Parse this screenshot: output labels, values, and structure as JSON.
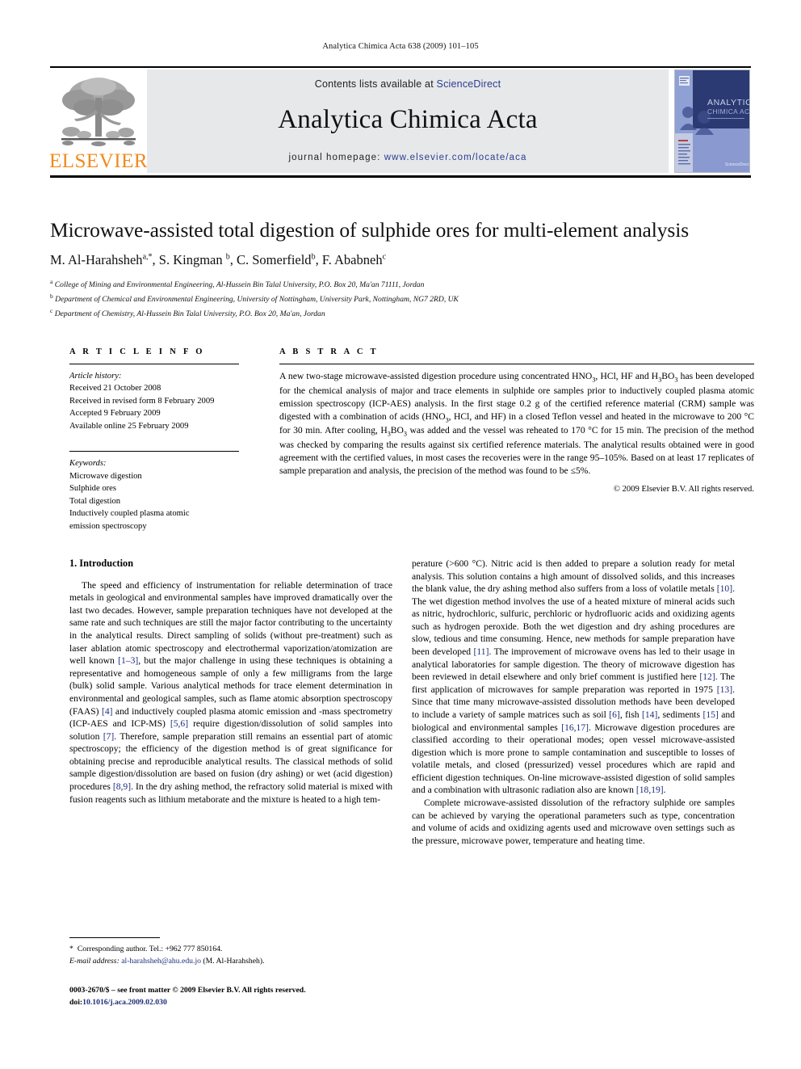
{
  "running_head": "Analytica Chimica Acta 638 (2009) 101–105",
  "masthead": {
    "contents_prefix": "Contents lists available at ",
    "sciencedirect": "ScienceDirect",
    "journal_name": "Analytica Chimica Acta",
    "homepage_label": "journal homepage:",
    "homepage_url": "www.elsevier.com/locate/aca",
    "publisher_wordmark": "ELSEVIER",
    "publisher_logo_icon": "elsevier-tree-icon",
    "cover_thumbnail_icon": "journal-cover-thumbnail",
    "cover_title_line1": "ANALYTICA",
    "cover_title_line2": "CHIMICA ACTA",
    "accent_orange": "#f08a1b",
    "link_blue": "#2a3d8f",
    "panel_grey": "#e7e8ea"
  },
  "article": {
    "title": "Microwave-assisted total digestion of sulphide ores for multi-element analysis",
    "authors_html": "M. Al-Harahsheh<sup>a,</sup><sup>*</sup>, S. Kingman <sup>b</sup>, C. Somerfield<sup>b</sup>, F. Ababneh<sup>c</sup>",
    "affiliations": [
      {
        "marker": "a",
        "text": "College of Mining and Environmental Engineering, Al-Hussein Bin Talal University, P.O. Box 20, Ma'an 71111, Jordan"
      },
      {
        "marker": "b",
        "text": "Department of Chemical and Environmental Engineering, University of Nottingham, University Park, Nottingham, NG7 2RD, UK"
      },
      {
        "marker": "c",
        "text": "Department of Chemistry, Al-Hussein Bin Talal University, P.O. Box 20, Ma'an, Jordan"
      }
    ]
  },
  "article_info": {
    "heading": "A R T I C L E  I N F O",
    "history_label": "Article history:",
    "history": [
      "Received 21 October 2008",
      "Received in revised form 8 February 2009",
      "Accepted 9 February 2009",
      "Available online 25 February 2009"
    ],
    "keywords_label": "Keywords:",
    "keywords": [
      "Microwave digestion",
      "Sulphide ores",
      "Total digestion",
      "Inductively coupled plasma atomic",
      "emission spectroscopy"
    ]
  },
  "abstract": {
    "heading": "A B S T R A C T",
    "body_html": "A new two-stage microwave-assisted digestion procedure using concentrated HNO<sub>3</sub>, HCl, HF and H<sub>3</sub>BO<sub>3</sub> has been developed for the chemical analysis of major and trace elements in sulphide ore samples prior to inductively coupled plasma atomic emission spectroscopy (ICP-AES) analysis. In the first stage 0.2 g of the certified reference material (CRM) sample was digested with a combination of acids (HNO<sub>3</sub>, HCl, and HF) in a closed Teflon vessel and heated in the microwave to 200 &deg;C for 30 min. After cooling, H<sub>3</sub>BO<sub>3</sub> was added and the vessel was reheated to 170 &deg;C for 15 min. The precision of the method was checked by comparing the results against six certified reference materials. The analytical results obtained were in good agreement with the certified values, in most cases the recoveries were in the range 95–105%. Based on at least 17 replicates of sample preparation and analysis, the precision of the method was found to be &le;5%.",
    "copyright": "© 2009 Elsevier B.V. All rights reserved."
  },
  "body": {
    "section_heading": "1.  Introduction",
    "left_paragraph_html": "The speed and efficiency of instrumentation for reliable determination of trace metals in geological and environmental samples have improved dramatically over the last two decades. However, sample preparation techniques have not developed at the same rate and such techniques are still the major factor contributing to the uncertainty in the analytical results. Direct sampling of solids (without pre-treatment) such as laser ablation atomic spectroscopy and electrothermal vaporization/atomization are well known <span class=\"ref\">[1–3]</span>, but the major challenge in using these techniques is obtaining a representative and homogeneous sample of only a few milligrams from the large (bulk) solid sample. Various analytical methods for trace element determination in environmental and geological samples, such as flame atomic absorption spectroscopy (FAAS) <span class=\"ref\">[4]</span> and inductively coupled plasma atomic emission and -mass spectrometry (ICP-AES and ICP-MS) <span class=\"ref\">[5,6]</span> require digestion/dissolution of solid samples into solution <span class=\"ref\">[7]</span>. Therefore, sample preparation still remains an essential part of atomic spectroscopy; the efficiency of the digestion method is of great significance for obtaining precise and reproducible analytical results. The classical methods of solid sample digestion/dissolution are based on fusion (dry ashing) or wet (acid digestion) procedures <span class=\"ref\">[8,9]</span>. In the dry ashing method, the refractory solid material is mixed with fusion reagents such as lithium metaborate and the mixture is heated to a high tem-",
    "right_paragraph_1_html": "perature (&gt;600 &deg;C). Nitric acid is then added to prepare a solution ready for metal analysis. This solution contains a high amount of dissolved solids, and this increases the blank value, the dry ashing method also suffers from a loss of volatile metals <span class=\"ref\">[10]</span>. The wet digestion method involves the use of a heated mixture of mineral acids such as nitric, hydrochloric, sulfuric, perchloric or hydrofluoric acids and oxidizing agents such as hydrogen peroxide. Both the wet digestion and dry ashing procedures are slow, tedious and time consuming. Hence, new methods for sample preparation have been developed <span class=\"ref\">[11]</span>. The improvement of microwave ovens has led to their usage in analytical laboratories for sample digestion. The theory of microwave digestion has been reviewed in detail elsewhere and only brief comment is justified here <span class=\"ref\">[12]</span>. The first application of microwaves for sample preparation was reported in 1975 <span class=\"ref\">[13]</span>. Since that time many microwave-assisted dissolution methods have been developed to include a variety of sample matrices such as soil <span class=\"ref\">[6]</span>, fish <span class=\"ref\">[14]</span>, sediments <span class=\"ref\">[15]</span> and biological and environmental samples <span class=\"ref\">[16,17]</span>. Microwave digestion procedures are classified according to their operational modes; open vessel microwave-assisted digestion which is more prone to sample contamination and susceptible to losses of volatile metals, and closed (pressurized) vessel procedures which are rapid and efficient digestion techniques. On-line microwave-assisted digestion of solid samples and a combination with ultrasonic radiation also are known <span class=\"ref\">[18,19]</span>.",
    "right_paragraph_2_html": "Complete microwave-assisted dissolution of the refractory sulphide ore samples can be achieved by varying the operational parameters such as type, concentration and volume of acids and oxidizing agents used and microwave oven settings such as the pressure, microwave power, temperature and heating time."
  },
  "footnotes": {
    "corresponding_star": "*",
    "corresponding_text": "Corresponding author. Tel.: +962 777 850164.",
    "email_label": "E-mail address:",
    "email": "al-harahsheh@ahu.edu.jo",
    "email_owner": "(M. Al-Harahsheh)."
  },
  "imprint": {
    "line1": "0003-2670/$ – see front matter © 2009 Elsevier B.V. All rights reserved.",
    "doi_label": "doi:",
    "doi": "10.1016/j.aca.2009.02.030"
  }
}
